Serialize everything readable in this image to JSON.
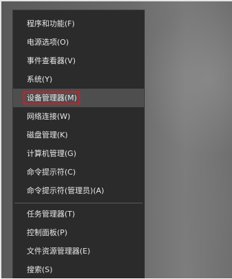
{
  "menu": {
    "items": [
      {
        "label": "程序和功能(F)"
      },
      {
        "label": "电源选项(O)"
      },
      {
        "label": "事件查看器(V)"
      },
      {
        "label": "系统(Y)"
      },
      {
        "label": "设备管理器(M)"
      },
      {
        "label": "网络连接(W)"
      },
      {
        "label": "磁盘管理(K)"
      },
      {
        "label": "计算机管理(G)"
      },
      {
        "label": "命令提示符(C)"
      },
      {
        "label": "命令提示符(管理员)(A)"
      },
      {
        "label": "任务管理器(T)"
      },
      {
        "label": "控制面板(P)"
      },
      {
        "label": "文件资源管理器(E)"
      },
      {
        "label": "搜索(S)"
      }
    ]
  },
  "colors": {
    "menu_background": "#2b2b2b",
    "hover_background": "#4e4e4e",
    "highlight_border": "#c8202a",
    "text": "#e8e8e8"
  }
}
